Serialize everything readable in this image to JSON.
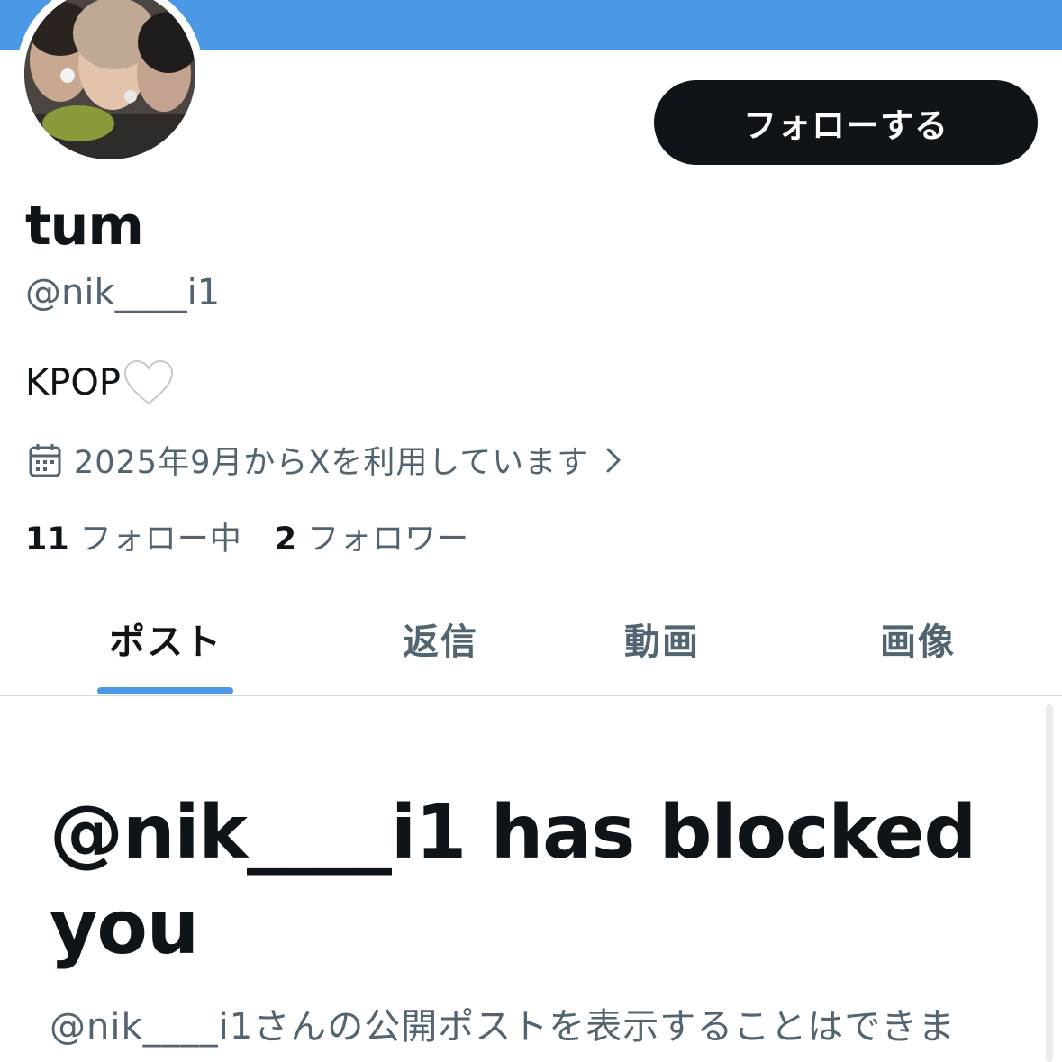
{
  "profile": {
    "follow_label": "フォローする",
    "display_name": "tum",
    "handle": "@nik____i1",
    "bio": "KPOP",
    "bio_emoji": "white-heart-icon",
    "joined_text": "2025年9月からXを利用しています",
    "following_count": "11",
    "following_label": "フォロー中",
    "followers_count": "2",
    "followers_label": "フォロワー"
  },
  "tabs": [
    {
      "label": "ポスト",
      "active": true
    },
    {
      "label": "返信",
      "active": false
    },
    {
      "label": "動画",
      "active": false
    },
    {
      "label": "画像",
      "active": false
    }
  ],
  "blocked": {
    "title": "@nik____i1 has blocked you",
    "description": "@nik____i1さんの公開ポストを表示することはできま"
  },
  "colors": {
    "banner": "#4a98e6",
    "accent": "#4a98e6",
    "primary_text": "#0f1419",
    "secondary_text": "#536471",
    "button_bg": "#0f1419"
  }
}
